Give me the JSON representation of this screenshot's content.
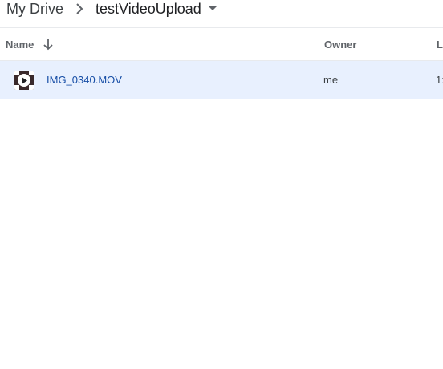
{
  "breadcrumb": {
    "root": "My Drive",
    "current": "testVideoUpload"
  },
  "columns": {
    "name": "Name",
    "owner": "Owner",
    "last_modified": "L"
  },
  "files": [
    {
      "name": "IMG_0340.MOV",
      "owner": "me",
      "last_modified": "1:"
    }
  ],
  "icons": {
    "breadcrumb_separator": "chevron-right-icon",
    "folder_menu": "caret-down-icon",
    "sort": "arrow-down-icon",
    "file_type": "video-play-icon"
  },
  "colors": {
    "selected_row": "#e8f0fe",
    "file_name": "#174ea6",
    "header_text": "#5f6368"
  }
}
